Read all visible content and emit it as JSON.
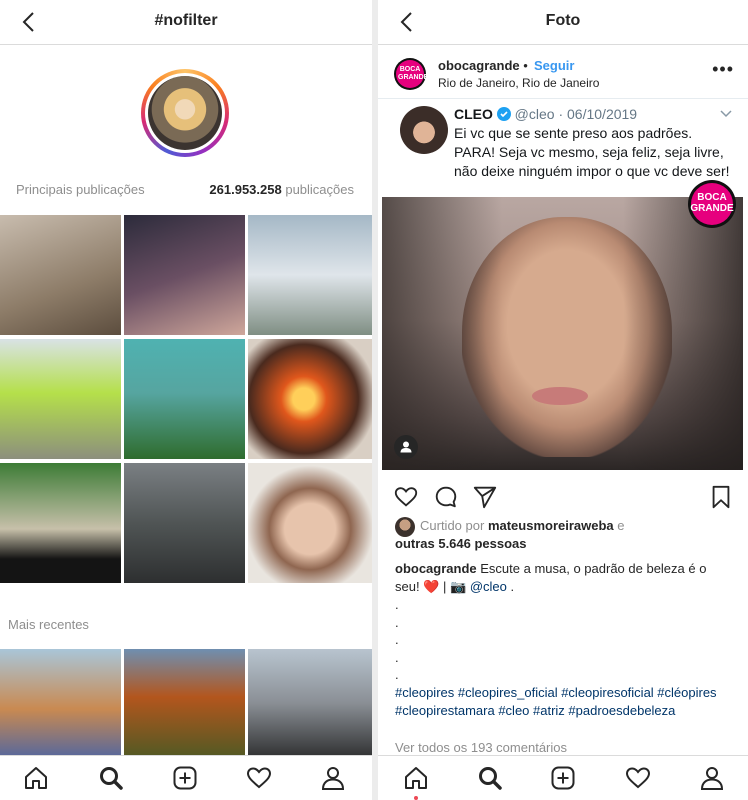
{
  "left": {
    "title": "#nofilter",
    "top_posts_label": "Principais publicações",
    "post_count": "261.953.258",
    "post_count_suffix": "publicações",
    "recent_label": "Mais recentes"
  },
  "right": {
    "title": "Foto",
    "username": "obocagrande",
    "separator": "•",
    "follow_label": "Seguir",
    "location": "Rio de Janeiro, Rio de Janeiro",
    "more_label": "•••",
    "badge_line1": "BOCA",
    "badge_line2": "GRANDE",
    "tweet": {
      "name": "CLEO",
      "handle": "@cleo",
      "date": "· 06/10/2019",
      "text": "Ei vc que se sente preso aos padrões. PARA! Seja vc mesmo, seja feliz, seja livre, não deixe ninguém impor o que vc deve ser!"
    },
    "liked_prefix": "Curtido por",
    "liked_user": "mateusmoreiraweba",
    "liked_and": "e",
    "liked_others": "outras 5.646 pessoas",
    "caption_user": "obocagrande",
    "caption_text": "Escute a musa, o padrão de beleza é o seu!",
    "caption_sep": "|",
    "caption_mention": "@cleo",
    "caption_dot": ".",
    "dots_lines": [
      ".",
      ".",
      ".",
      ".",
      "."
    ],
    "hashtags": "#cleopires #cleopires_oficial #cleopiresoficial #cléopires #cleopirestamara #cleo #atriz #padroesdebeleza",
    "view_comments": "Ver todos os 193 comentários"
  },
  "colors": {
    "link": "#3897f0",
    "hashtag": "#003569",
    "muted": "#8e8e8e",
    "heart": "#ed4956",
    "badge_bg": "#e6007e"
  },
  "icons": [
    "back-arrow-icon",
    "home-icon",
    "search-icon",
    "new-post-icon",
    "heart-icon",
    "profile-icon",
    "comment-icon",
    "share-icon",
    "bookmark-icon",
    "verified-icon",
    "person-tag-icon"
  ]
}
